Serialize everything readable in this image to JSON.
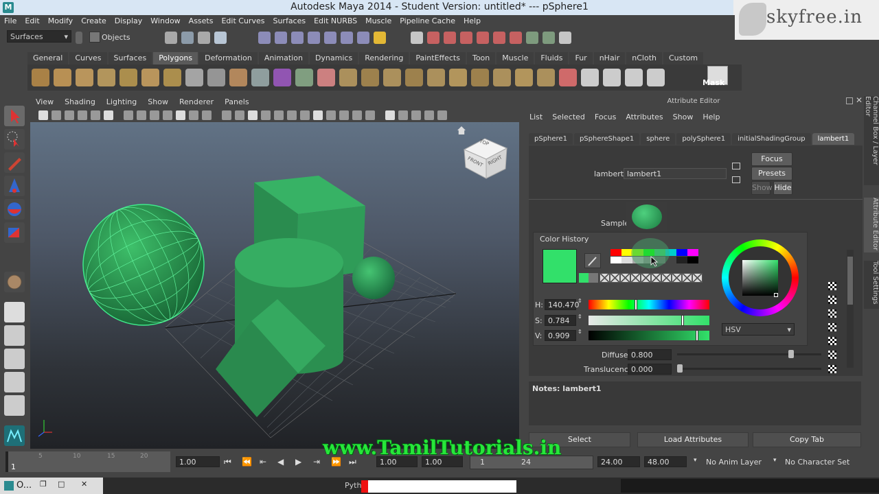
{
  "window": {
    "title": "Autodesk Maya 2014 - Student Version: untitled*   ---   pSphere1",
    "app_icon": "maya-icon"
  },
  "watermark_site": "skyfree.in",
  "menubar": [
    "File",
    "Edit",
    "Modify",
    "Create",
    "Display",
    "Window",
    "Assets",
    "Edit Curves",
    "Surfaces",
    "Edit NURBS",
    "Muscle",
    "Pipeline Cache",
    "Help"
  ],
  "status": {
    "menuset": "Surfaces",
    "selection_mode": "Objects"
  },
  "shelf_tabs": [
    "General",
    "Curves",
    "Surfaces",
    "Polygons",
    "Deformation",
    "Animation",
    "Dynamics",
    "Rendering",
    "PaintEffects",
    "Toon",
    "Muscle",
    "Fluids",
    "Fur",
    "nHair",
    "nCloth",
    "Custom"
  ],
  "shelf_active_tab": "Polygons",
  "shelf_mask_label": "Mask",
  "viewport_menu": [
    "View",
    "Shading",
    "Lighting",
    "Show",
    "Renderer",
    "Panels"
  ],
  "viewcube": {
    "top": "TOP",
    "front": "FRONT",
    "right": "RIGHT"
  },
  "attribute_editor": {
    "title": "Attribute Editor",
    "menu": [
      "List",
      "Selected",
      "Focus",
      "Attributes",
      "Show",
      "Help"
    ],
    "tabs": [
      "pSphere1",
      "pSphereShape1",
      "sphere",
      "polySphere1",
      "initialShadingGroup",
      "lambert1"
    ],
    "active_tab": "lambert1",
    "node_type_label": "lambert:",
    "node_name": "lambert1",
    "focus_btn": "Focus",
    "presets_btn": "Presets",
    "show_btn": "Show",
    "hide_btn": "Hide",
    "sample_label": "Sample",
    "diffuse_label": "Diffuse",
    "diffuse_value": "0.800",
    "translucence_label": "Translucence",
    "translucence_value": "0.000",
    "notes_label": "Notes: lambert1",
    "bottom_buttons": [
      "Select",
      "Load Attributes",
      "Copy Tab"
    ]
  },
  "side_tabs": [
    "Channel Box / Layer Editor",
    "Attribute Editor",
    "Tool Settings"
  ],
  "color_picker": {
    "history_label": "Color History",
    "h_label": "H:",
    "h_value": "140.470",
    "s_label": "S:",
    "s_value": "0.784",
    "v_label": "V:",
    "v_value": "0.909",
    "mode": "HSV",
    "current_color": "#32e06a",
    "h_level": 0.39,
    "s_level": 0.784,
    "v_level": 0.909
  },
  "timeline": {
    "ticks": [
      "1",
      "5",
      "10",
      "15",
      "20"
    ],
    "current_frame": "1.00",
    "start": "1.00",
    "start2": "1.00",
    "range_start": "1",
    "range_end": "24",
    "end": "24.00",
    "end2": "48.00",
    "anim_layer": "No Anim Layer",
    "char_set": "No Character Set"
  },
  "taskbar": {
    "app_label": "O...",
    "python_label": "Pyth"
  },
  "footer_watermark": "www.TamilTutorials.in",
  "colors": {
    "object_green": "#2e9e52",
    "select_green": "#39e07a",
    "bg": "#444444"
  }
}
